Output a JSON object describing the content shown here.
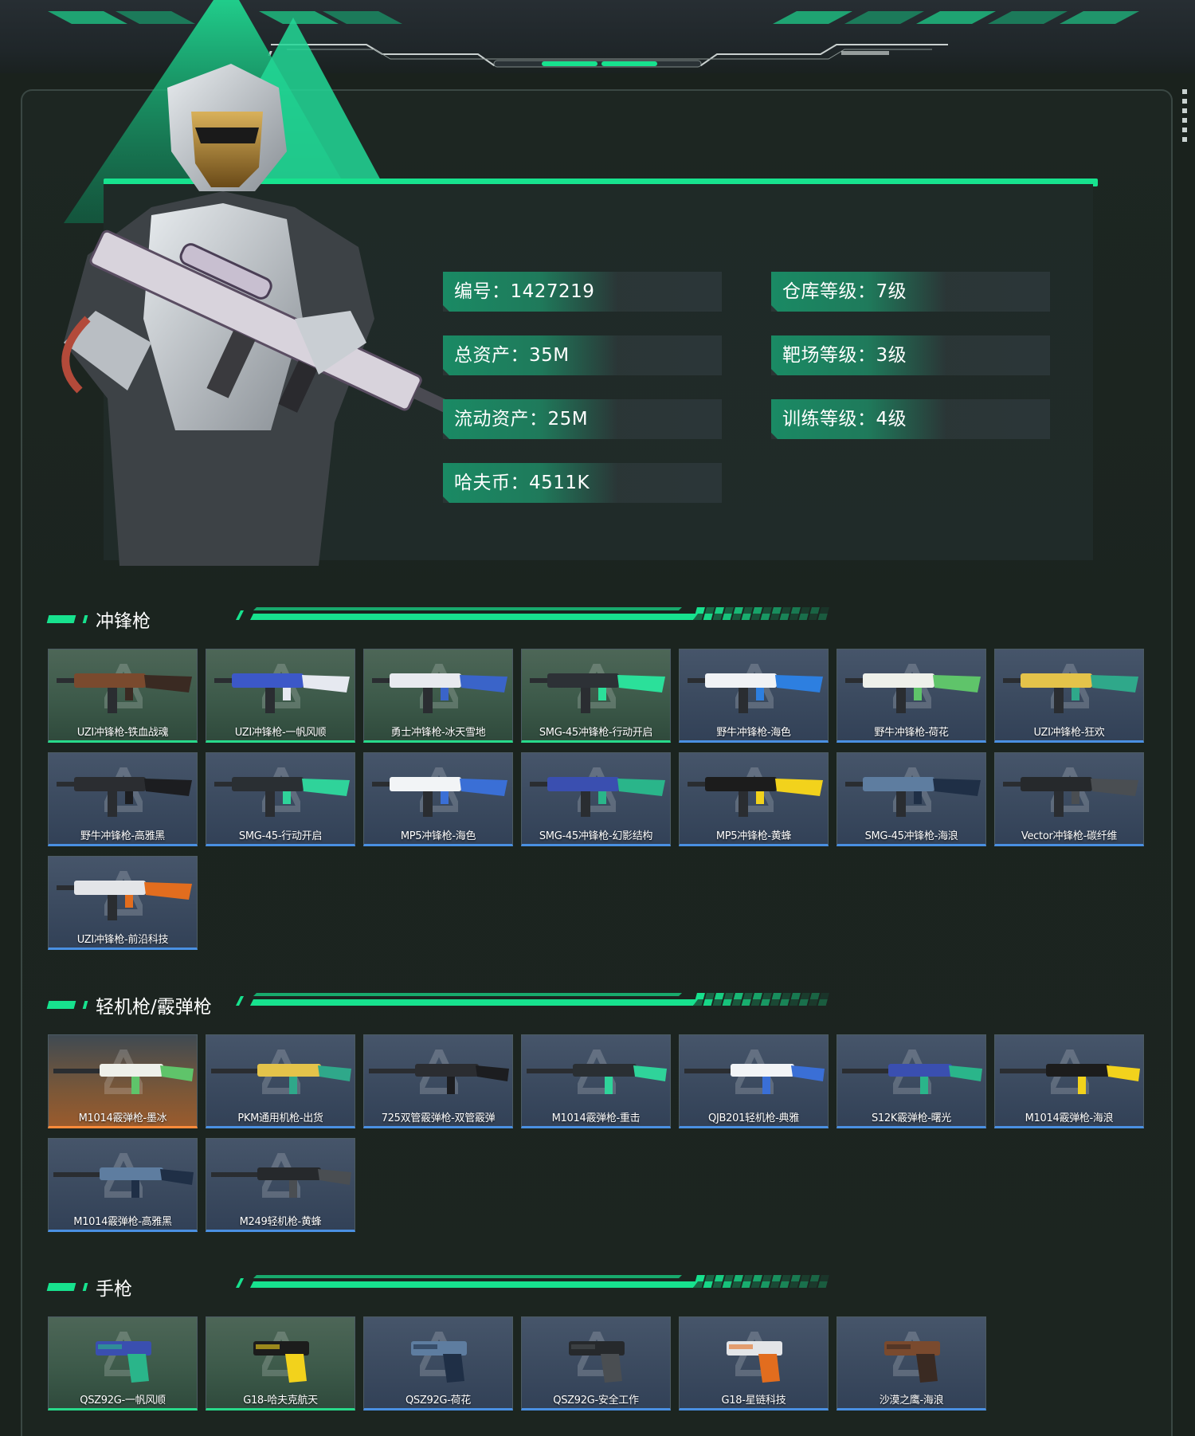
{
  "profile": {
    "stats_left": [
      {
        "label": "编号：1427219"
      },
      {
        "label": "总资产：35M"
      },
      {
        "label": "流动资产：25M"
      },
      {
        "label": "哈夫币：4511K"
      }
    ],
    "stats_right": [
      {
        "label": "仓库等级：7级"
      },
      {
        "label": "靶场等级：3级"
      },
      {
        "label": "训练等级：4级"
      }
    ]
  },
  "sections": [
    {
      "title": "冲锋枪",
      "items": [
        {
          "name": "UZI冲锋枪-铁血战魂",
          "rarity": "green"
        },
        {
          "name": "UZI冲锋枪-一帆风顺",
          "rarity": "green"
        },
        {
          "name": "勇士冲锋枪-冰天雪地",
          "rarity": "green"
        },
        {
          "name": "SMG-45冲锋枪-行动开启",
          "rarity": "green"
        },
        {
          "name": "野牛冲锋枪-海色",
          "rarity": "blue"
        },
        {
          "name": "野牛冲锋枪-荷花",
          "rarity": "blue"
        },
        {
          "name": "UZI冲锋枪-狂欢",
          "rarity": "blue"
        },
        {
          "name": "野牛冲锋枪-高雅黑",
          "rarity": "blue"
        },
        {
          "name": "SMG-45-行动开启",
          "rarity": "blue"
        },
        {
          "name": "MP5冲锋枪-海色",
          "rarity": "blue"
        },
        {
          "name": "SMG-45冲锋枪-幻影结构",
          "rarity": "blue"
        },
        {
          "name": "MP5冲锋枪-黄蜂",
          "rarity": "blue"
        },
        {
          "name": "SMG-45冲锋枪-海浪",
          "rarity": "blue"
        },
        {
          "name": "Vector冲锋枪-碳纤维",
          "rarity": "blue"
        },
        {
          "name": "UZI冲锋枪-前沿科技",
          "rarity": "blue"
        }
      ]
    },
    {
      "title": "轻机枪/霰弹枪",
      "items": [
        {
          "name": "M1014霰弹枪-墨冰",
          "rarity": "orange"
        },
        {
          "name": "PKM通用机枪-出货",
          "rarity": "blue"
        },
        {
          "name": "725双管霰弹枪-双管霰弹",
          "rarity": "blue"
        },
        {
          "name": "M1014霰弹枪-重击",
          "rarity": "blue"
        },
        {
          "name": "QJB201轻机枪-典雅",
          "rarity": "blue"
        },
        {
          "name": "S12K霰弹枪-曙光",
          "rarity": "blue"
        },
        {
          "name": "M1014霰弹枪-海浪",
          "rarity": "blue"
        },
        {
          "name": "M1014霰弹枪-高雅黑",
          "rarity": "blue"
        },
        {
          "name": "M249轻机枪-黄蜂",
          "rarity": "blue"
        }
      ]
    },
    {
      "title": "手枪",
      "items": [
        {
          "name": "QSZ92G-一帆风顺",
          "rarity": "green"
        },
        {
          "name": "G18-哈夫克航天",
          "rarity": "green"
        },
        {
          "name": "QSZ92G-荷花",
          "rarity": "blue"
        },
        {
          "name": "QSZ92G-安全工作",
          "rarity": "blue"
        },
        {
          "name": "G18-星链科技",
          "rarity": "blue"
        },
        {
          "name": "沙漠之鹰-海浪",
          "rarity": "blue"
        }
      ]
    }
  ],
  "colors": {
    "accent": "#17e28e",
    "rarity_green": "#28d98a",
    "rarity_blue": "#4a90e2",
    "rarity_orange": "#ff8b3a"
  },
  "icons": {
    "hero": "soldier-character-icon",
    "card_watermark": "delta-logo-icon"
  }
}
